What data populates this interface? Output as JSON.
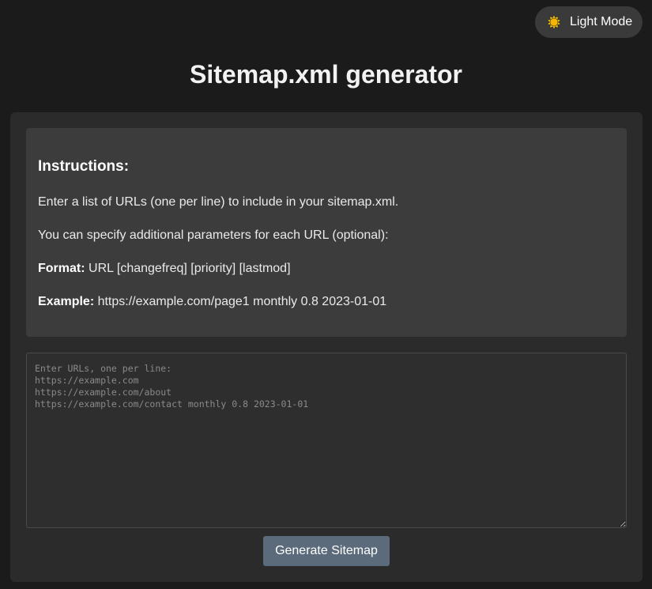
{
  "theme_toggle": {
    "label": "Light Mode",
    "icon": "sun-icon",
    "icon_color": "#f5c518"
  },
  "page": {
    "title": "Sitemap.xml generator"
  },
  "instructions": {
    "heading": "Instructions:",
    "line1": "Enter a list of URLs (one per line) to include in your sitemap.xml.",
    "line2": "You can specify additional parameters for each URL (optional):",
    "format_label": "Format:",
    "format_value": " URL [changefreq] [priority] [lastmod]",
    "example_label": "Example:",
    "example_value": " https://example.com/page1 monthly 0.8 2023-01-01"
  },
  "url_input": {
    "value": "",
    "placeholder": "Enter URLs, one per line:\nhttps://example.com\nhttps://example.com/about\nhttps://example.com/contact monthly 0.8 2023-01-01"
  },
  "actions": {
    "generate_label": "Generate Sitemap"
  },
  "colors": {
    "background": "#1b1b1b",
    "card": "#2b2b2b",
    "instructions_panel": "#3c3c3c",
    "button": "#5b6b7c"
  }
}
